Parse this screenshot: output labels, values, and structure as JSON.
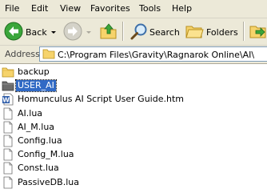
{
  "menu": {
    "file": "File",
    "edit": "Edit",
    "view": "View",
    "favorites": "Favorites",
    "tools": "Tools",
    "help": "Help"
  },
  "toolbar": {
    "back_label": "Back",
    "search_label": "Search",
    "folders_label": "Folders"
  },
  "address": {
    "label": "Address",
    "value": "C:\\Program Files\\Gravity\\Ragnarok Online\\AI\\"
  },
  "files": [
    {
      "name": "backup",
      "type": "folder",
      "selected": false
    },
    {
      "name": "USER_AI",
      "type": "folder-dark",
      "selected": true
    },
    {
      "name": "Homunculus AI Script User Guide.htm",
      "type": "htm",
      "selected": false
    },
    {
      "name": "AI.lua",
      "type": "file",
      "selected": false
    },
    {
      "name": "AI_M.lua",
      "type": "file",
      "selected": false
    },
    {
      "name": "Config.lua",
      "type": "file",
      "selected": false
    },
    {
      "name": "Config_M.lua",
      "type": "file",
      "selected": false
    },
    {
      "name": "Const.lua",
      "type": "file",
      "selected": false
    },
    {
      "name": "PassiveDB.lua",
      "type": "file",
      "selected": false
    }
  ],
  "colors": {
    "chrome": "#ece9d8",
    "selection": "#316ac5",
    "back_arrow": "#2e9a2e",
    "folder": "#f6d36b"
  }
}
